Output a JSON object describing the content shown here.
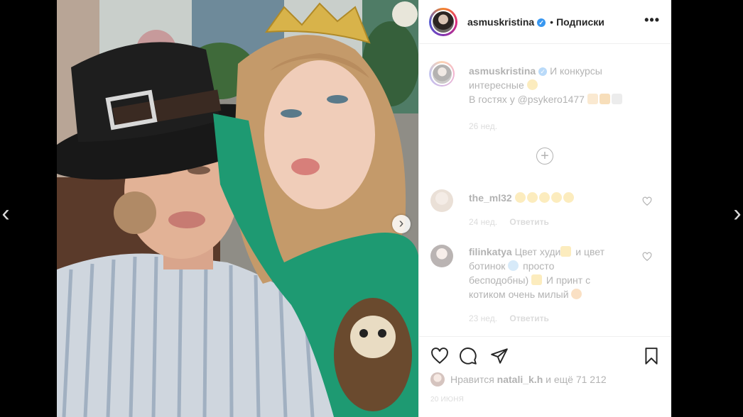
{
  "header": {
    "username": "asmuskristina",
    "separator": "•",
    "follow_label": "Подписки",
    "more_label": "•••"
  },
  "caption": {
    "username": "asmuskristina",
    "text_line1": "И конкурсы",
    "text_line2": "интересные",
    "text_line3": "В гостях у @psykero1477",
    "time": "26 нед."
  },
  "load_more_label": "+",
  "comments": [
    {
      "username": "the_ml32",
      "text": "",
      "time": "24 нед.",
      "reply_label": "Ответить"
    },
    {
      "username": "filinkatya",
      "text_line1": "Цвет худи",
      "text_line1b": "и цвет",
      "text_line2a": "ботинок",
      "text_line2b": "просто",
      "text_line3": "бесподобны)",
      "text_line3b": "И принт с",
      "text_line4": "котиком очень милый",
      "time": "23 нед.",
      "reply_label": "Ответить"
    }
  ],
  "likes": {
    "prefix": "Нравится",
    "user": "natali_k.h",
    "suffix": "и ещё 71 212"
  },
  "post_date": "20 ИЮНЯ",
  "nav": {
    "prev": "‹",
    "next": "›",
    "carousel_next": "›"
  },
  "colors": {
    "accent_verified": "#3897f0",
    "text_primary": "#262626",
    "text_secondary": "#999999"
  }
}
